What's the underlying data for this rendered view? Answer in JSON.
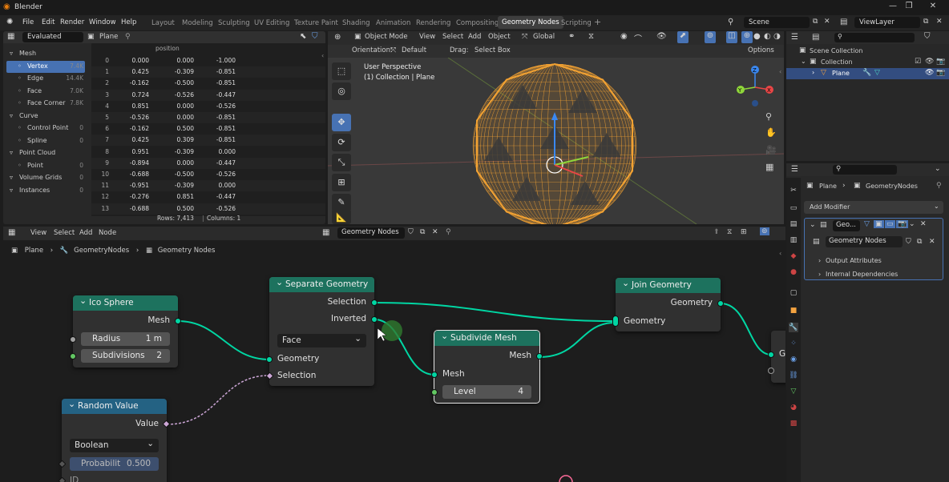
{
  "titlebar": {
    "title": "Blender",
    "minimize": "—",
    "maximize": "❐",
    "close": "✕"
  },
  "menubar": {
    "menus": [
      "File",
      "Edit",
      "Render",
      "Window",
      "Help"
    ],
    "workspaces": [
      "Layout",
      "Modeling",
      "Sculpting",
      "UV Editing",
      "Texture Paint",
      "Shading",
      "Animation",
      "Rendering",
      "Compositing",
      "Geometry Nodes",
      "Scripting"
    ],
    "active_workspace": "Geometry Nodes",
    "add_tab": "+",
    "scene": "Scene",
    "view_layer": "ViewLayer"
  },
  "spreadsheet": {
    "evaluated": "Evaluated",
    "object": "Plane",
    "column_header": "position",
    "tree": [
      {
        "label": "Mesh",
        "count": "",
        "level": 0,
        "icon": "mesh-icon"
      },
      {
        "label": "Vertex",
        "count": "7.4K",
        "level": 1,
        "icon": "vertex-icon",
        "active": true
      },
      {
        "label": "Edge",
        "count": "14.4K",
        "level": 1,
        "icon": "edge-icon"
      },
      {
        "label": "Face",
        "count": "7.0K",
        "level": 1,
        "icon": "face-icon"
      },
      {
        "label": "Face Corner",
        "count": "7.8K",
        "level": 1,
        "icon": "face-corner-icon"
      },
      {
        "label": "Curve",
        "count": "",
        "level": 0,
        "icon": "curve-icon"
      },
      {
        "label": "Control Point",
        "count": "0",
        "level": 1,
        "icon": "control-point-icon"
      },
      {
        "label": "Spline",
        "count": "0",
        "level": 1,
        "icon": "spline-icon"
      },
      {
        "label": "Point Cloud",
        "count": "",
        "level": 0,
        "icon": "point-cloud-icon"
      },
      {
        "label": "Point",
        "count": "0",
        "level": 1,
        "icon": "point-icon"
      },
      {
        "label": "Volume Grids",
        "count": "0",
        "level": 0,
        "icon": "volume-icon"
      },
      {
        "label": "Instances",
        "count": "0",
        "level": 0,
        "icon": "instances-icon"
      }
    ],
    "rows": [
      [
        "0",
        "0.000",
        "0.000",
        "-1.000"
      ],
      [
        "1",
        "0.425",
        "-0.309",
        "-0.851"
      ],
      [
        "2",
        "-0.162",
        "-0.500",
        "-0.851"
      ],
      [
        "3",
        "0.724",
        "-0.526",
        "-0.447"
      ],
      [
        "4",
        "0.851",
        "0.000",
        "-0.526"
      ],
      [
        "5",
        "-0.526",
        "0.000",
        "-0.851"
      ],
      [
        "6",
        "-0.162",
        "0.500",
        "-0.851"
      ],
      [
        "7",
        "0.425",
        "0.309",
        "-0.851"
      ],
      [
        "8",
        "0.951",
        "-0.309",
        "0.000"
      ],
      [
        "9",
        "-0.894",
        "0.000",
        "-0.447"
      ],
      [
        "10",
        "-0.688",
        "-0.500",
        "-0.526"
      ],
      [
        "11",
        "-0.951",
        "-0.309",
        "0.000"
      ],
      [
        "12",
        "-0.276",
        "0.851",
        "-0.447"
      ],
      [
        "13",
        "-0.688",
        "0.500",
        "-0.526"
      ]
    ],
    "footer_rows": "Rows: 7,413",
    "footer_cols": "Columns: 1"
  },
  "viewport": {
    "mode": "Object Mode",
    "menus": [
      "View",
      "Select",
      "Add",
      "Object"
    ],
    "transform": "Global",
    "orientation_label": "Orientation:",
    "orientation_value": "Default",
    "drag_label": "Drag:",
    "drag_value": "Select Box",
    "options": "Options",
    "perspective": "User Perspective",
    "collection": "(1) Collection | Plane",
    "gizmo": {
      "x": "X",
      "y": "Y",
      "z": "Z"
    },
    "mesh_color": "#f2a233"
  },
  "outliner": {
    "rows": [
      {
        "label": "Scene Collection",
        "icon": "scene-collection-icon"
      },
      {
        "label": "Collection",
        "icon": "collection-icon"
      },
      {
        "label": "Plane",
        "icon": "mesh-object-icon",
        "selected": true
      }
    ]
  },
  "properties": {
    "object": "Plane",
    "modifier_group": "GeometryNodes",
    "add_modifier": "Add Modifier",
    "modifier_name": "Geo...",
    "node_group": "Geometry Nodes",
    "panels": [
      "Output Attributes",
      "Internal Dependencies"
    ]
  },
  "node_editor": {
    "menus": [
      "View",
      "Select",
      "Add",
      "Node"
    ],
    "tree_name": "Geometry Nodes",
    "breadcrumb": [
      "Plane",
      "GeometryNodes",
      "Geometry Nodes"
    ],
    "nodes": {
      "ico_sphere": {
        "title": "Ico Sphere",
        "out_mesh": "Mesh",
        "radius_label": "Radius",
        "radius_value": "1 m",
        "subdiv_label": "Subdivisions",
        "subdiv_value": "2"
      },
      "separate": {
        "title": "Separate Geometry",
        "out_selection": "Selection",
        "out_inverted": "Inverted",
        "domain": "Face",
        "in_geometry": "Geometry",
        "in_selection": "Selection"
      },
      "subdivide": {
        "title": "Subdivide Mesh",
        "out_mesh": "Mesh",
        "in_mesh": "Mesh",
        "level_label": "Level",
        "level_value": "4"
      },
      "join": {
        "title": "Join Geometry",
        "out_geometry": "Geometry",
        "in_geometry": "Geometry"
      },
      "random": {
        "title": "Random Value",
        "out_value": "Value",
        "type": "Boolean",
        "prob_label": "Probabilit",
        "prob_value": "0.500",
        "id_label": "ID"
      },
      "output_partial": {
        "label": "G"
      }
    }
  }
}
